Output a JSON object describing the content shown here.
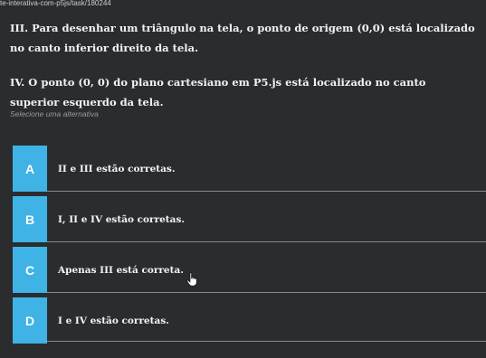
{
  "browser": {
    "url_fragment": "te-interativa-com-p5js/task/180244"
  },
  "question": {
    "statement_iii": "III. Para desenhar um triângulo na tela, o ponto de origem (0,0) está localizado no canto inferior direito da tela.",
    "statement_iv": "IV. O ponto (0, 0) do plano cartesiano em P5.js está localizado no canto superior esquerdo da tela.",
    "select_label": "Selecione uma alternativa"
  },
  "options": [
    {
      "letter": "A",
      "text": "II e III estão corretas."
    },
    {
      "letter": "B",
      "text": "I, II e IV estão corretas."
    },
    {
      "letter": "C",
      "text": "Apenas III está correta."
    },
    {
      "letter": "D",
      "text": "I e IV estão corretas."
    }
  ],
  "colors": {
    "background": "#2b2c2e",
    "badge": "#3fb3e6",
    "text": "#f2f2f2"
  },
  "icons": {
    "cursor": "hand-pointer-icon"
  }
}
